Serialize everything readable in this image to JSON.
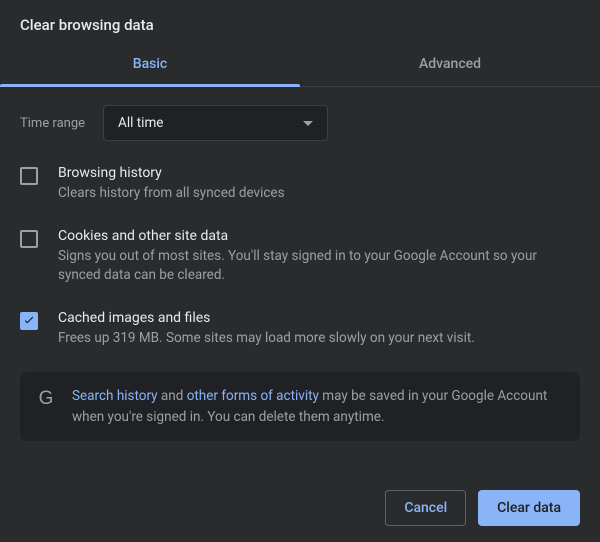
{
  "title": "Clear browsing data",
  "tabs": {
    "basic": "Basic",
    "advanced": "Advanced"
  },
  "range": {
    "label": "Time range",
    "value": "All time"
  },
  "options": [
    {
      "title": "Browsing history",
      "desc": "Clears history from all synced devices",
      "checked": false
    },
    {
      "title": "Cookies and other site data",
      "desc": "Signs you out of most sites. You'll stay signed in to your Google Account so your synced data can be cleared.",
      "checked": false
    },
    {
      "title": "Cached images and files",
      "desc": "Frees up 319 MB. Some sites may load more slowly on your next visit.",
      "checked": true
    }
  ],
  "info": {
    "link1": "Search history",
    "mid1": " and ",
    "link2": "other forms of activity",
    "rest": " may be saved in your Google Account when you're signed in. You can delete them anytime."
  },
  "buttons": {
    "cancel": "Cancel",
    "confirm": "Clear data"
  }
}
